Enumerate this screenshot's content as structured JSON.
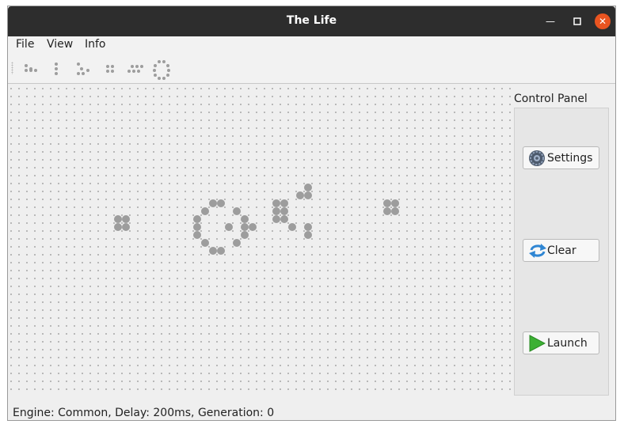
{
  "window": {
    "title": "The Life"
  },
  "menu": {
    "file": "File",
    "view": "View",
    "info": "Info"
  },
  "toolbar": {
    "patterns": [
      "glider",
      "blinker",
      "glider-alt",
      "block",
      "line",
      "ring"
    ]
  },
  "board": {
    "live_cells": [
      [
        13,
        16
      ],
      [
        13,
        17
      ],
      [
        14,
        16
      ],
      [
        14,
        17
      ],
      [
        25,
        14
      ],
      [
        26,
        14
      ],
      [
        24,
        15
      ],
      [
        28,
        15
      ],
      [
        23,
        16
      ],
      [
        29,
        16
      ],
      [
        23,
        17
      ],
      [
        27,
        17
      ],
      [
        29,
        17
      ],
      [
        30,
        17
      ],
      [
        23,
        18
      ],
      [
        29,
        18
      ],
      [
        24,
        19
      ],
      [
        28,
        19
      ],
      [
        25,
        20
      ],
      [
        26,
        20
      ],
      [
        37,
        12
      ],
      [
        36,
        13
      ],
      [
        37,
        13
      ],
      [
        33,
        14
      ],
      [
        34,
        14
      ],
      [
        33,
        15
      ],
      [
        34,
        15
      ],
      [
        33,
        16
      ],
      [
        34,
        16
      ],
      [
        35,
        17
      ],
      [
        37,
        17
      ],
      [
        37,
        18
      ],
      [
        47,
        14
      ],
      [
        48,
        14
      ],
      [
        47,
        15
      ],
      [
        48,
        15
      ]
    ]
  },
  "panel": {
    "title": "Control Panel",
    "settings": "Settings",
    "clear": "Clear",
    "launch": "Launch"
  },
  "status": {
    "text": "Engine: Common, Delay: 200ms, Generation: 0"
  }
}
